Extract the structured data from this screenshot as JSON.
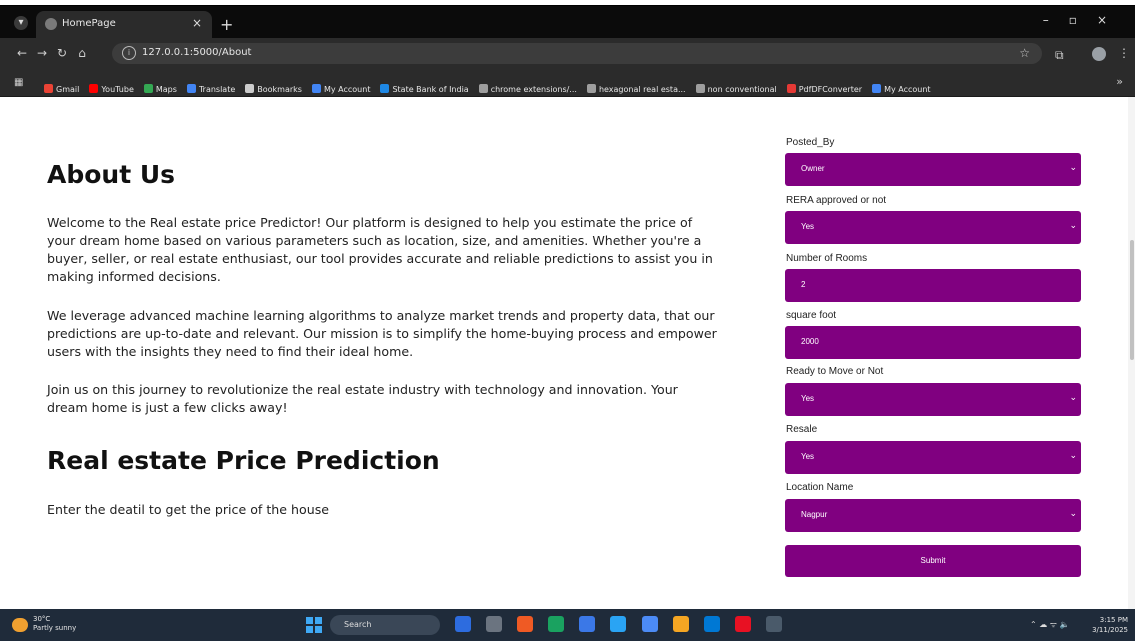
{
  "browser": {
    "tab_title": "HomePage",
    "url": "127.0.0.1:5000/About",
    "bookmarks": [
      {
        "label": "Gmail",
        "color": "#ea4335"
      },
      {
        "label": "YouTube",
        "color": "#ff0000"
      },
      {
        "label": "Maps",
        "color": "#34a853"
      },
      {
        "label": "Translate",
        "color": "#4285f4"
      },
      {
        "label": "Bookmarks",
        "color": "#cccccc"
      },
      {
        "label": "My Account",
        "color": "#4285f4"
      },
      {
        "label": "State Bank of India",
        "color": "#1e88e5"
      },
      {
        "label": "chrome extensions/...",
        "color": "#9e9e9e"
      },
      {
        "label": "hexagonal real esta...",
        "color": "#9e9e9e"
      },
      {
        "label": "non conventional",
        "color": "#9e9e9e"
      },
      {
        "label": "PdfDFConverter",
        "color": "#e53935"
      },
      {
        "label": "My Account",
        "color": "#4285f4"
      }
    ]
  },
  "about": {
    "heading": "About Us",
    "p1": "Welcome to the Real estate price Predictor! Our platform is designed to help you estimate the price of your dream home based on various parameters such as location, size, and amenities. Whether you're a buyer, seller, or real estate enthusiast, our tool provides accurate and reliable predictions to assist you in making informed decisions.",
    "p2": "We leverage advanced machine learning algorithms to analyze market trends and property data, that our predictions are up-to-date and relevant. Our mission is to simplify the home-buying process and empower users with the insights they need to find their ideal home.",
    "p3": "Join us on this journey to revolutionize the real estate industry with technology and innovation. Your dream home is just a few clicks away!"
  },
  "prediction": {
    "heading": "Real estate Price Prediction",
    "text": "Enter the deatil to get the price of the house"
  },
  "form": {
    "posted_by_label": "Posted_By",
    "posted_by_value": "Owner",
    "rera_label": "RERA approved or not",
    "rera_value": "Yes",
    "rooms_label": "Number of Rooms",
    "rooms_value": "2",
    "sqft_label": "square foot",
    "sqft_value": "2000",
    "ready_label": "Ready to Move or Not",
    "ready_value": "Yes",
    "resale_label": "Resale",
    "resale_value": "Yes",
    "location_label": "Location Name",
    "location_value": "Nagpur",
    "submit_label": "Submit",
    "accent_color": "#800080"
  },
  "taskbar": {
    "weather_temp": "30°C",
    "weather_desc": "Partly sunny",
    "search_label": "Search",
    "time": "3:15 PM",
    "date": "3/11/2025"
  }
}
